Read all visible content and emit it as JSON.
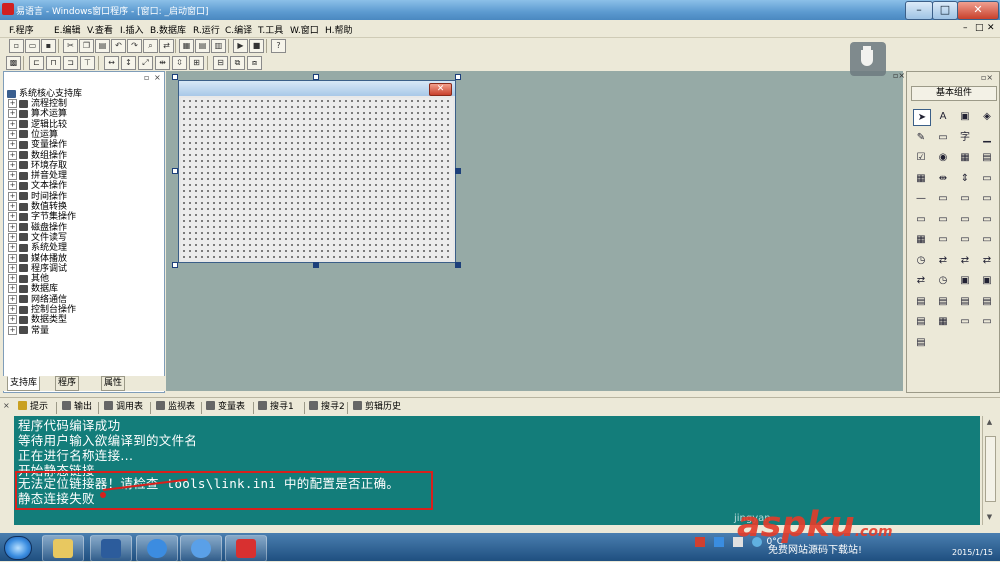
{
  "window": {
    "title": "易语言 - Windows窗口程序 - [窗口: _启动窗口]",
    "minimize": "–",
    "maximize": "□",
    "close": "✕"
  },
  "menu": [
    "F.程序",
    "E.编辑",
    "V.查看",
    "I.插入",
    "B.数据库",
    "R.运行",
    "C.编译",
    "T.工具",
    "W.窗口",
    "H.帮助"
  ],
  "menu_right": [
    "–",
    "□",
    "✕"
  ],
  "left_panel": {
    "root": "系统核心支持库",
    "items": [
      "流程控制",
      "算术运算",
      "逻辑比较",
      "位运算",
      "变量操作",
      "数组操作",
      "环境存取",
      "拼音处理",
      "文本操作",
      "时间操作",
      "数值转换",
      "字节集操作",
      "磁盘操作",
      "文件读写",
      "系统处理",
      "媒体播放",
      "程序调试",
      "其他",
      "数据库",
      "网络通信",
      "控制台操作",
      "数据类型",
      "常量"
    ],
    "tabs": [
      "支持库",
      "程序",
      "属性"
    ]
  },
  "right_panel": {
    "header": "基本组件"
  },
  "output_tabs": [
    "提示",
    "输出",
    "调用表",
    "监视表",
    "变量表",
    "搜寻1",
    "搜寻2",
    "剪辑历史"
  ],
  "output_lines": [
    "程序代码编译成功",
    "等待用户输入欲编译到的文件名",
    "正在进行名称连接...",
    "开始静态链接",
    "无法定位链接器！请检查 tools\\link.ini 中的配置是否正确。",
    "静态连接失败"
  ],
  "taskbar": {
    "tray_temp": "0°C",
    "tray_time": "2015/1/15"
  },
  "watermark": {
    "brand": "aspku",
    "suffix": ".com",
    "faint": "jingyan",
    "sub": "免费网站源码下载站!"
  },
  "colors": {
    "output_bg": "#137d7a",
    "designer_bg": "#96aaa6",
    "highlight": "#d8201c"
  }
}
